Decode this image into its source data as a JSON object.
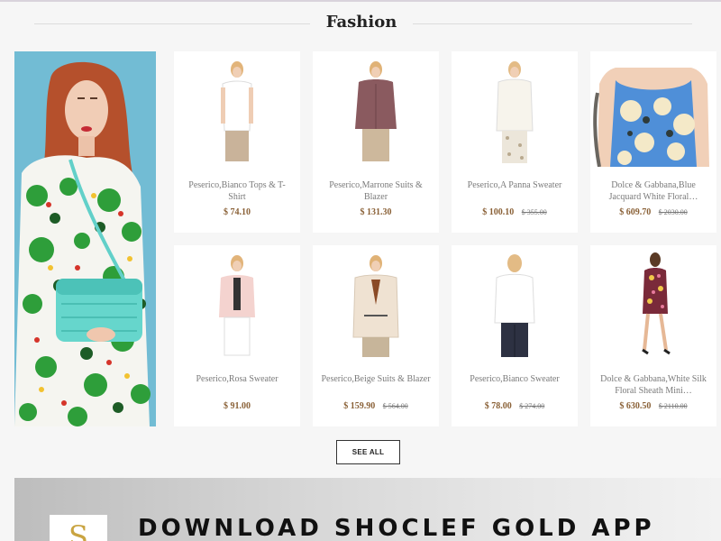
{
  "section": {
    "title": "Fashion"
  },
  "products": [
    {
      "name": "Peserico,Bianco Tops & T-Shirt",
      "price": "$ 74.10",
      "old_price": ""
    },
    {
      "name": "Peserico,Marrone Suits & Blazer",
      "price": "$ 131.30",
      "old_price": ""
    },
    {
      "name": "Peserico,A Panna Sweater",
      "price": "$ 100.10",
      "old_price": "$ 355.00"
    },
    {
      "name": "Dolce & Gabbana,Blue Jacquard White Floral…",
      "price": "$ 609.70",
      "old_price": "$ 2030.00"
    },
    {
      "name": "Peserico,Rosa Sweater",
      "price": "$ 91.00",
      "old_price": ""
    },
    {
      "name": "Peserico,Beige Suits & Blazer",
      "price": "$ 159.90",
      "old_price": "$ 564.00"
    },
    {
      "name": "Peserico,Bianco Sweater",
      "price": "$ 78.00",
      "old_price": "$ 274.00"
    },
    {
      "name": "Dolce & Gabbana,White Silk Floral Sheath Mini…",
      "price": "$ 630.50",
      "old_price": "$ 2110.00"
    }
  ],
  "see_all_label": "SEE ALL",
  "promo": {
    "logo_letter": "S",
    "headline": "DOWNLOAD SHOCLEF GOLD APP"
  },
  "colors": {
    "price": "#8a6137",
    "background": "#f6f6f6",
    "banner_sky": "#6ab6cf"
  },
  "icons": [
    "model-banner-image",
    "product-photo",
    "app-logo"
  ]
}
